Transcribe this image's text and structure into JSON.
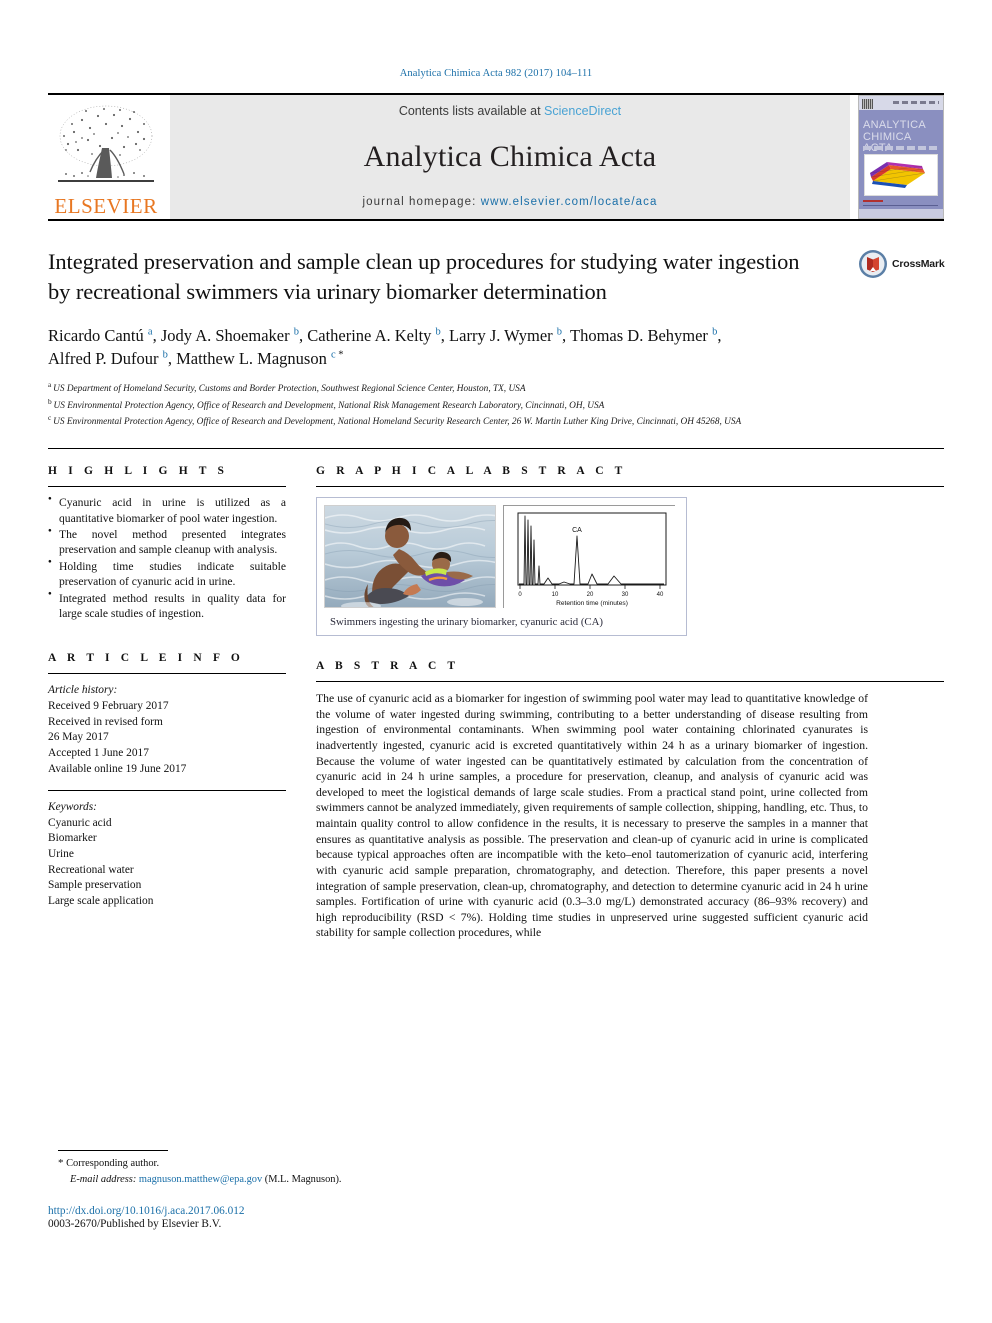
{
  "running_head": "Analytica Chimica Acta 982 (2017) 104–111",
  "masthead": {
    "publisher": "ELSEVIER",
    "contents_prefix": "Contents lists available at ",
    "contents_link": "ScienceDirect",
    "journal_name": "Analytica Chimica Acta",
    "homepage_prefix": "journal homepage: ",
    "homepage_url": "www.elsevier.com/locate/aca",
    "cover_title": "ANALYTICA CHIMICA ACTA"
  },
  "title": "Integrated preservation and sample clean up procedures for studying water ingestion by recreational swimmers via urinary biomarker determination",
  "crossmark_label": "CrossMark",
  "authors": [
    {
      "name": "Ricardo Cantú",
      "sup": "a",
      "sep": ", "
    },
    {
      "name": "Jody A. Shoemaker",
      "sup": "b",
      "sep": ", "
    },
    {
      "name": "Catherine A. Kelty",
      "sup": "b",
      "sep": ", "
    },
    {
      "name": "Larry J. Wymer",
      "sup": "b",
      "sep": ", "
    },
    {
      "name": "Thomas D. Behymer",
      "sup": "b",
      "sep": ", "
    },
    {
      "name": "Alfred P. Dufour",
      "sup": "b",
      "sep": ", "
    },
    {
      "name": "Matthew L. Magnuson",
      "sup": "c",
      "star": "*",
      "sep": ""
    }
  ],
  "affiliations": [
    {
      "mark": "a",
      "text": "US Department of Homeland Security, Customs and Border Protection, Southwest Regional Science Center, Houston, TX, USA"
    },
    {
      "mark": "b",
      "text": "US Environmental Protection Agency, Office of Research and Development, National Risk Management Research Laboratory, Cincinnati, OH, USA"
    },
    {
      "mark": "c",
      "text": "US Environmental Protection Agency, Office of Research and Development, National Homeland Security Research Center, 26 W. Martin Luther King Drive, Cincinnati, OH 45268, USA"
    }
  ],
  "sections": {
    "highlights_heading": "H I G H L I G H T S",
    "graphical_abstract_heading": "G R A P H I C A L  A B S T R A C T",
    "article_info_heading": "A R T I C L E  I N F O",
    "abstract_heading": "A B S T R A C T"
  },
  "highlights": [
    "Cyanuric acid in urine is utilized as a quantitative biomarker of pool water ingestion.",
    "The novel method presented integrates preservation and sample cleanup with analysis.",
    "Holding time studies indicate suitable preservation of cyanuric acid in urine.",
    "Integrated method results in quality data for large scale studies of ingestion."
  ],
  "article_info": {
    "history_label": "Article history:",
    "history": [
      "Received 9 February 2017",
      "Received in revised form",
      "26 May 2017",
      "Accepted 1 June 2017",
      "Available online 19 June 2017"
    ],
    "keywords_label": "Keywords:",
    "keywords": [
      "Cyanuric acid",
      "Biomarker",
      "Urine",
      "Recreational water",
      "Sample preservation",
      "Large scale application"
    ]
  },
  "graphical_abstract": {
    "caption": "Swimmers ingesting the urinary biomarker, cyanuric acid (CA)",
    "photo_alt": "Swimmer and child in pool water",
    "chart_data": {
      "type": "line",
      "title": "",
      "xlabel": "Retention time (minutes)",
      "ylabel": "",
      "xlim": [
        0,
        45
      ],
      "ylim": [
        0,
        100
      ],
      "xticks": [
        0,
        10,
        20,
        30,
        40
      ],
      "grid": false,
      "annotations": [
        {
          "label": "CA",
          "x": 18.5,
          "y": 72
        }
      ],
      "series": [
        {
          "name": "chromatogram",
          "peaks": [
            {
              "x": 2.2,
              "height": 96,
              "width": 0.5
            },
            {
              "x": 2.9,
              "height": 88,
              "width": 0.5
            },
            {
              "x": 3.5,
              "height": 78,
              "width": 0.6
            },
            {
              "x": 4.2,
              "height": 55,
              "width": 0.8
            },
            {
              "x": 6.5,
              "height": 18,
              "width": 0.9
            },
            {
              "x": 11.5,
              "height": 9,
              "width": 1.8
            },
            {
              "x": 18.5,
              "height": 64,
              "width": 1.2
            },
            {
              "x": 26.5,
              "height": 14,
              "width": 1.6
            },
            {
              "x": 36.0,
              "height": 9,
              "width": 2.2
            }
          ],
          "baseline": 3
        }
      ]
    }
  },
  "abstract": "The use of cyanuric acid as a biomarker for ingestion of swimming pool water may lead to quantitative knowledge of the volume of water ingested during swimming, contributing to a better understanding of disease resulting from ingestion of environmental contaminants. When swimming pool water containing chlorinated cyanurates is inadvertently ingested, cyanuric acid is excreted quantitatively within 24 h as a urinary biomarker of ingestion. Because the volume of water ingested can be quantitatively estimated by calculation from the concentration of cyanuric acid in 24 h urine samples, a procedure for preservation, cleanup, and analysis of cyanuric acid was developed to meet the logistical demands of large scale studies. From a practical stand point, urine collected from swimmers cannot be analyzed immediately, given requirements of sample collection, shipping, handling, etc. Thus, to maintain quality control to allow confidence in the results, it is necessary to preserve the samples in a manner that ensures as quantitative analysis as possible. The preservation and clean-up of cyanuric acid in urine is complicated because typical approaches often are incompatible with the keto–enol tautomerization of cyanuric acid, interfering with cyanuric acid sample preparation, chromatography, and detection. Therefore, this paper presents a novel integration of sample preservation, clean-up, chromatography, and detection to determine cyanuric acid in 24 h urine samples. Fortification of urine with cyanuric acid (0.3–3.0 mg/L) demonstrated accuracy (86–93% recovery) and high reproducibility (RSD < 7%). Holding time studies in unpreserved urine suggested sufficient cyanuric acid stability for sample collection procedures, while",
  "footer": {
    "corresponding_star": "*",
    "corresponding_label": "Corresponding author.",
    "email_label": "E-mail address:",
    "email": "magnuson.matthew@epa.gov",
    "email_suffix": "(M.L. Magnuson).",
    "doi": "http://dx.doi.org/10.1016/j.aca.2017.06.012",
    "issn": "0003-2670/Published by Elsevier B.V."
  },
  "colors": {
    "link_blue": "#1a6fa8",
    "sciencedirect_blue": "#4aa3d4",
    "elsevier_orange": "#E87722",
    "band_grey": "#e9e9e9"
  }
}
